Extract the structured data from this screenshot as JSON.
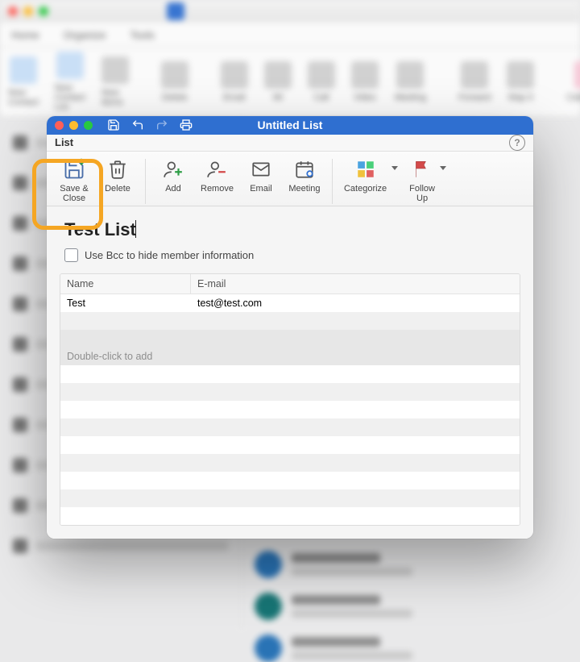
{
  "background": {
    "tabs": [
      "Home",
      "Organize",
      "Tools"
    ],
    "ribbon": [
      "New Contact",
      "New Contact List",
      "New Items",
      "Delete",
      "Email",
      "IM",
      "Call",
      "Video",
      "Meeting",
      "Forward",
      "Map It",
      "Categorize"
    ]
  },
  "modal": {
    "title": "Untitled List",
    "tab": "List",
    "ribbon": {
      "save_close": "Save &\nClose",
      "delete": "Delete",
      "add": "Add",
      "remove": "Remove",
      "email": "Email",
      "meeting": "Meeting",
      "categorize": "Categorize",
      "follow_up": "Follow\nUp"
    },
    "list_name": "Test List",
    "bcc_label": "Use Bcc to hide member information",
    "columns": {
      "name": "Name",
      "email": "E-mail"
    },
    "rows": [
      {
        "name": "Test",
        "email": "test@test.com"
      }
    ],
    "add_placeholder": "Double-click to add"
  },
  "colors": {
    "accent": "#2f6fd0",
    "highlight": "#f5a623"
  }
}
